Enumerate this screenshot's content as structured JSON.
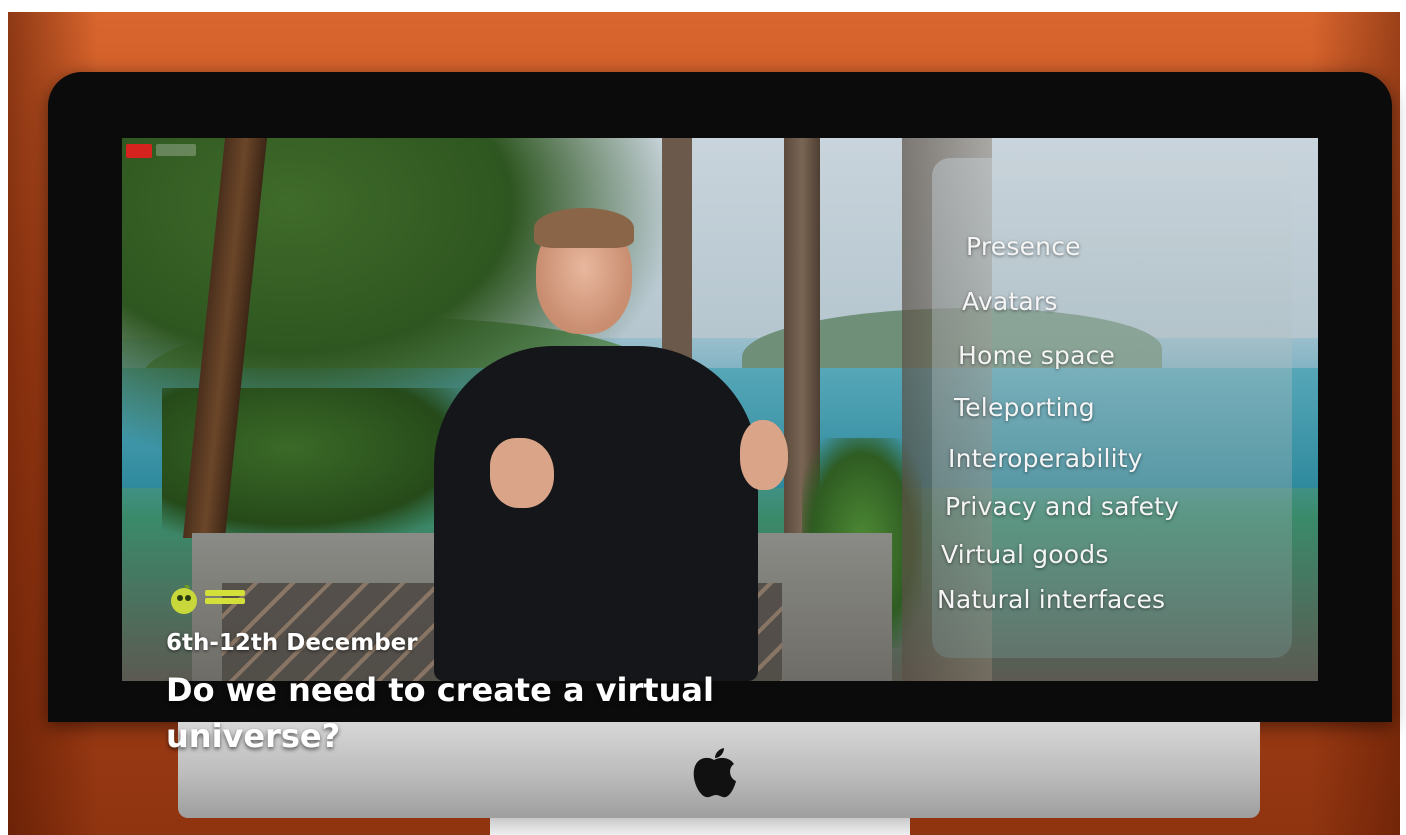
{
  "presentation": {
    "topics": [
      {
        "label": "Presence"
      },
      {
        "label": "Avatars"
      },
      {
        "label": "Home space"
      },
      {
        "label": "Teleporting"
      },
      {
        "label": "Interoperability"
      },
      {
        "label": "Privacy and safety"
      },
      {
        "label": "Virtual goods"
      },
      {
        "label": "Natural interfaces"
      }
    ]
  },
  "caption": {
    "date": "6th-12th December",
    "headline": "Do we need to create a virtual universe?"
  },
  "colors": {
    "frame": "#c5551f",
    "bezel": "#0b0b0b",
    "chin": "#c4c4c4",
    "caption_text": "#ffffff",
    "logo_accent": "#d4e03a"
  },
  "icons": {
    "brand_logo": "newspaper-logo-icon",
    "device_logo": "apple-icon",
    "live_badge": "live-badge-icon"
  }
}
